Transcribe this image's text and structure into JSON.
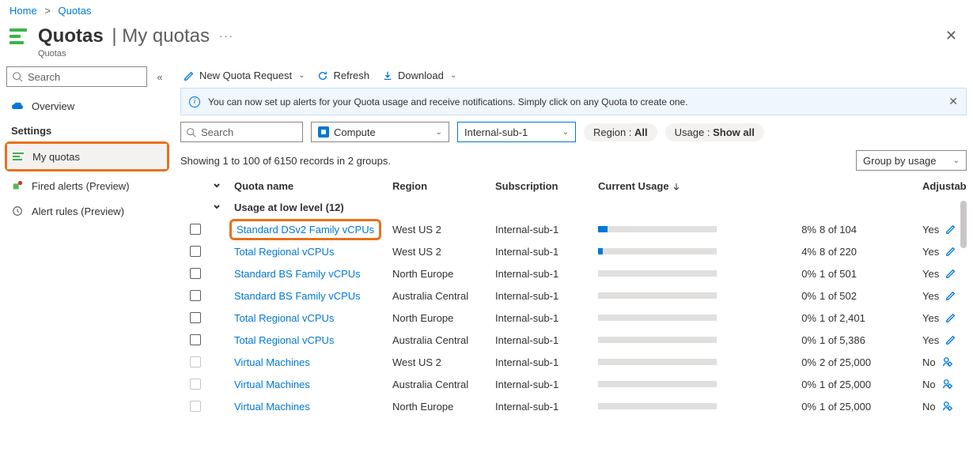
{
  "breadcrumb": {
    "home": "Home",
    "quotas": "Quotas"
  },
  "header": {
    "title": "Quotas",
    "subtitle": "My quotas",
    "resource_type": "Quotas",
    "ellipsis": "···",
    "close": "✕"
  },
  "sidebar": {
    "search_placeholder": "Search",
    "collapse_label": "«",
    "overview": "Overview",
    "section_settings": "Settings",
    "my_quotas": "My quotas",
    "fired_alerts": "Fired alerts (Preview)",
    "alert_rules": "Alert rules (Preview)"
  },
  "toolbar": {
    "new_request": "New Quota Request",
    "refresh": "Refresh",
    "download": "Download"
  },
  "banner": {
    "text": "You can now set up alerts for your Quota usage and receive notifications. Simply click on any Quota to create one.",
    "close": "✕"
  },
  "filters": {
    "search_placeholder": "Search",
    "provider_value": "Compute",
    "subscription_value": "Internal-sub-1",
    "region_label": "Region : ",
    "region_value": "All",
    "usage_label": "Usage : ",
    "usage_value": "Show all"
  },
  "results": {
    "count_text": "Showing 1 to 100 of 6150 records in 2 groups.",
    "group_by_value": "Group by usage"
  },
  "columns": {
    "name": "Quota name",
    "region": "Region",
    "subscription": "Subscription",
    "usage": "Current Usage",
    "adjustable": "Adjustable"
  },
  "group": {
    "title": "Usage at low level (12)"
  },
  "rows": [
    {
      "name": "Standard DSv2 Family vCPUs",
      "region": "West US 2",
      "sub": "Internal-sub-1",
      "pct": "8%",
      "of": "8 of 104",
      "adj": "Yes",
      "bar": 8,
      "hl": true
    },
    {
      "name": "Total Regional vCPUs",
      "region": "West US 2",
      "sub": "Internal-sub-1",
      "pct": "4%",
      "of": "8 of 220",
      "adj": "Yes",
      "bar": 4
    },
    {
      "name": "Standard BS Family vCPUs",
      "region": "North Europe",
      "sub": "Internal-sub-1",
      "pct": "0%",
      "of": "1 of 501",
      "adj": "Yes",
      "bar": 0
    },
    {
      "name": "Standard BS Family vCPUs",
      "region": "Australia Central",
      "sub": "Internal-sub-1",
      "pct": "0%",
      "of": "1 of 502",
      "adj": "Yes",
      "bar": 0
    },
    {
      "name": "Total Regional vCPUs",
      "region": "North Europe",
      "sub": "Internal-sub-1",
      "pct": "0%",
      "of": "1 of 2,401",
      "adj": "Yes",
      "bar": 0
    },
    {
      "name": "Total Regional vCPUs",
      "region": "Australia Central",
      "sub": "Internal-sub-1",
      "pct": "0%",
      "of": "1 of 5,386",
      "adj": "Yes",
      "bar": 0
    },
    {
      "name": "Virtual Machines",
      "region": "West US 2",
      "sub": "Internal-sub-1",
      "pct": "0%",
      "of": "2 of 25,000",
      "adj": "No",
      "bar": 0,
      "adjno": true,
      "dis": true
    },
    {
      "name": "Virtual Machines",
      "region": "Australia Central",
      "sub": "Internal-sub-1",
      "pct": "0%",
      "of": "1 of 25,000",
      "adj": "No",
      "bar": 0,
      "adjno": true,
      "dis": true
    },
    {
      "name": "Virtual Machines",
      "region": "North Europe",
      "sub": "Internal-sub-1",
      "pct": "0%",
      "of": "1 of 25,000",
      "adj": "No",
      "bar": 0,
      "adjno": true,
      "dis": true
    }
  ]
}
